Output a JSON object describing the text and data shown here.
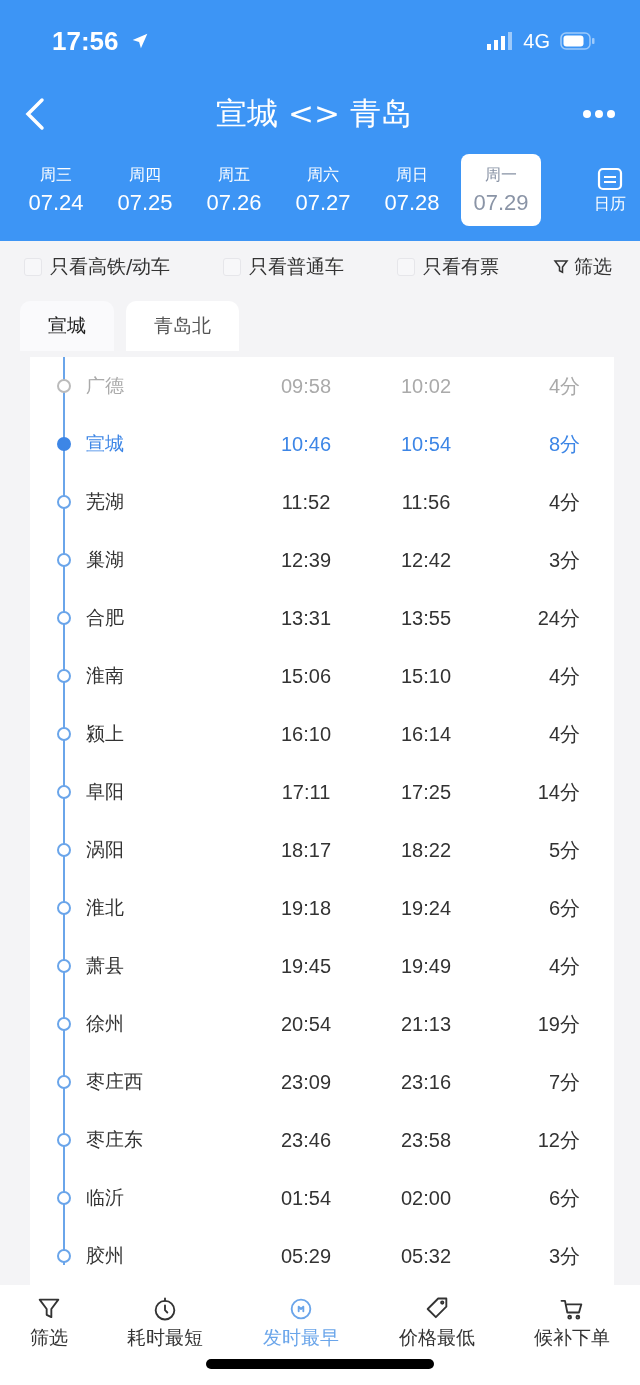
{
  "status_bar": {
    "time": "17:56",
    "network": "4G"
  },
  "header": {
    "title": "宣城 <> 青岛"
  },
  "dates": [
    {
      "weekday": "周三",
      "date": "07.24",
      "selected": false
    },
    {
      "weekday": "周四",
      "date": "07.25",
      "selected": false
    },
    {
      "weekday": "周五",
      "date": "07.26",
      "selected": false
    },
    {
      "weekday": "周六",
      "date": "07.27",
      "selected": false
    },
    {
      "weekday": "周日",
      "date": "07.28",
      "selected": false
    },
    {
      "weekday": "周一",
      "date": "07.29",
      "selected": true
    }
  ],
  "calendar_label": "日历",
  "filters": [
    {
      "label": "只看高铁/动车",
      "checked": false
    },
    {
      "label": "只看普通车",
      "checked": false
    },
    {
      "label": "只看有票",
      "checked": false
    }
  ],
  "filter_button": "筛选",
  "station_tabs": [
    {
      "label": "宣城",
      "selected": true
    },
    {
      "label": "青岛北",
      "selected": false
    }
  ],
  "stops": [
    {
      "station": "广德",
      "arrive": "09:58",
      "depart": "10:02",
      "stay": "4分",
      "passed": true,
      "selected": false
    },
    {
      "station": "宣城",
      "arrive": "10:46",
      "depart": "10:54",
      "stay": "8分",
      "passed": false,
      "selected": true
    },
    {
      "station": "芜湖",
      "arrive": "11:52",
      "depart": "11:56",
      "stay": "4分",
      "passed": false,
      "selected": false
    },
    {
      "station": "巢湖",
      "arrive": "12:39",
      "depart": "12:42",
      "stay": "3分",
      "passed": false,
      "selected": false
    },
    {
      "station": "合肥",
      "arrive": "13:31",
      "depart": "13:55",
      "stay": "24分",
      "passed": false,
      "selected": false
    },
    {
      "station": "淮南",
      "arrive": "15:06",
      "depart": "15:10",
      "stay": "4分",
      "passed": false,
      "selected": false
    },
    {
      "station": "颍上",
      "arrive": "16:10",
      "depart": "16:14",
      "stay": "4分",
      "passed": false,
      "selected": false
    },
    {
      "station": "阜阳",
      "arrive": "17:11",
      "depart": "17:25",
      "stay": "14分",
      "passed": false,
      "selected": false
    },
    {
      "station": "涡阳",
      "arrive": "18:17",
      "depart": "18:22",
      "stay": "5分",
      "passed": false,
      "selected": false
    },
    {
      "station": "淮北",
      "arrive": "19:18",
      "depart": "19:24",
      "stay": "6分",
      "passed": false,
      "selected": false
    },
    {
      "station": "萧县",
      "arrive": "19:45",
      "depart": "19:49",
      "stay": "4分",
      "passed": false,
      "selected": false
    },
    {
      "station": "徐州",
      "arrive": "20:54",
      "depart": "21:13",
      "stay": "19分",
      "passed": false,
      "selected": false
    },
    {
      "station": "枣庄西",
      "arrive": "23:09",
      "depart": "23:16",
      "stay": "7分",
      "passed": false,
      "selected": false
    },
    {
      "station": "枣庄东",
      "arrive": "23:46",
      "depart": "23:58",
      "stay": "12分",
      "passed": false,
      "selected": false
    },
    {
      "station": "临沂",
      "arrive": "01:54",
      "depart": "02:00",
      "stay": "6分",
      "passed": false,
      "selected": false
    },
    {
      "station": "胶州",
      "arrive": "05:29",
      "depart": "05:32",
      "stay": "3分",
      "passed": false,
      "selected": false
    }
  ],
  "bottom_nav": [
    {
      "label": "筛选",
      "kind": "filter",
      "selected": false
    },
    {
      "label": "耗时最短",
      "kind": "clock",
      "selected": false
    },
    {
      "label": "发时最早",
      "kind": "early",
      "selected": true
    },
    {
      "label": "价格最低",
      "kind": "tag",
      "selected": false
    },
    {
      "label": "候补下单",
      "kind": "cart",
      "selected": false
    }
  ]
}
